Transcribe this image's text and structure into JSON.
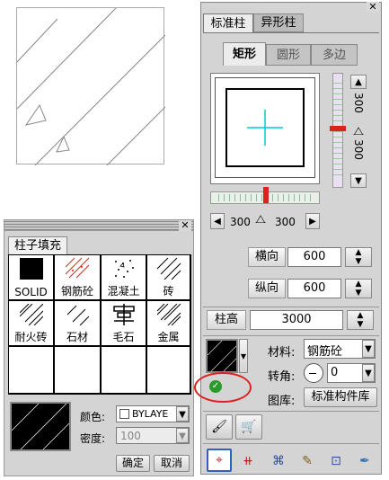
{
  "fill_panel": {
    "title": "柱子填充",
    "patterns": [
      {
        "label": "SOLID"
      },
      {
        "label": "钢筋砼"
      },
      {
        "label": "混凝土"
      },
      {
        "label": "砖"
      },
      {
        "label": "耐火砖"
      },
      {
        "label": "石材"
      },
      {
        "label": "毛石"
      },
      {
        "label": "金属"
      }
    ],
    "color_label": "颜色:",
    "color_value": "BYLAYE",
    "density_label": "密度:",
    "density_value": "100",
    "ok_label": "确定",
    "cancel_label": "取消"
  },
  "column_panel": {
    "tabs": [
      "标准柱",
      "异形柱"
    ],
    "shape_tabs": [
      "矩形",
      "圆形",
      "多边"
    ],
    "dim_right": "300",
    "dim_right2": "300",
    "dim_bottom_left": "300",
    "dim_bottom_right": "300",
    "horizontal_label": "横向",
    "horizontal_value": "600",
    "vertical_label": "纵向",
    "vertical_value": "600",
    "height_label": "柱高",
    "height_value": "3000",
    "material_label": "材料:",
    "material_value": "钢筋砼",
    "rotation_label": "转角:",
    "rotation_value": "0",
    "library_label": "图库:",
    "library_value": "标准构件库"
  },
  "colors": {
    "accent_red": "#e02020",
    "cursor_cyan": "#00c8d8",
    "panel_bg": "#d4d4d4"
  }
}
